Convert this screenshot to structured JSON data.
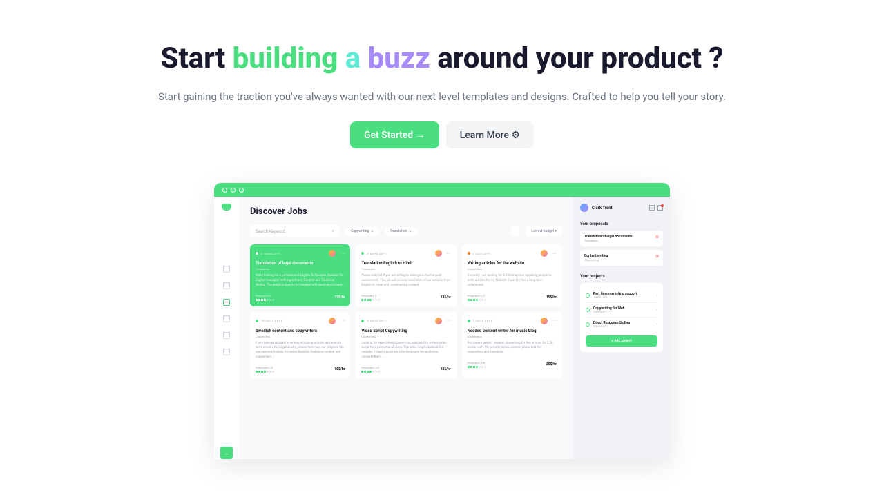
{
  "hero": {
    "title_pre": "Start ",
    "title_g1": "building ",
    "title_g2": "a ",
    "title_g3": "buzz",
    "title_post": " around your product ?",
    "subtitle": "Start gaining the traction you've always wanted with our next-level templates and designs. Crafted to help you tell your story.",
    "cta_primary": "Get Started →",
    "cta_secondary": "Learn More ⚙"
  },
  "app": {
    "heading": "Discover Jobs",
    "search_placeholder": "Search Keyword",
    "chip1": "Copywriting",
    "chip2": "Translation",
    "sort": "Lowest budget",
    "cards": [
      {
        "days": "4 DAYS LEFT",
        "title": "Translation of legal documents",
        "sub": "Translation",
        "desc": "We're looking for a professional English-To-Russian, Russian-To-English translator with expertise in Content and Technical Writing. The script is soon to be finished with exact word count...",
        "prop": "Proposers 8",
        "rate": "12$/hr"
      },
      {
        "days": "5 DAYS LEFT",
        "title": "Translation English to Hindi",
        "sub": "Translation",
        "desc": "Please only bid if you are willing to undergo a short unpaid assessment. This job will include translation of our website from English to Hindi and proofreading content.",
        "prop": "Proposers 5",
        "rate": "13$/hr"
      },
      {
        "days": "1 DAY LEFT",
        "title": "Writing articles for the website",
        "sub": "Copywriting",
        "desc": "Currently I am looking for 2-3 Vietnamese speaking people to write articles for my Website. I want to find a long-term collaborator.",
        "prop": "Proposers 2/5",
        "rate": "15$/hr"
      },
      {
        "days": "10 DAYS LEFT",
        "title": "Swedish content and copywriters",
        "sub": "Copywriting",
        "desc": "If you have a passion for writing intriguing articles and want to write about a thriving industry, please then read our job post. We are currently looking for native Swedish freelance content and copywriters...",
        "prop": "Proposers 2/8",
        "rate": "16$/hr"
      },
      {
        "days": "4 DAYS LEFT",
        "title": "Video Script Copywriting",
        "sub": "Copywriting",
        "desc": "Looking for expert level Copywriting specialist to write a video script for a promotional video. The video length is about 2-3 minutes. I need a good story that engages the audience, converts them...",
        "prop": "Proposers 3/8",
        "rate": "18$/hr"
      },
      {
        "days": "2 DAYS LEFT",
        "title": "Needed content writer for music blog",
        "sub": "Copywriting",
        "desc": "For current project needed copywriting for five articles for 2.5k words each. We provide topics, content plans, text for copywriting and keywords.",
        "prop": "Proposers 3/8",
        "rate": "20$/hr"
      }
    ]
  },
  "right": {
    "user": "Clark Trent",
    "proposals_title": "Your proposals",
    "proposals": [
      {
        "title": "Translation of legal documents",
        "sub": "Translation"
      },
      {
        "title": "Content writing",
        "sub": "Copywriting"
      }
    ],
    "projects_title": "Your projects",
    "projects": [
      {
        "title": "Part time marketing support",
        "meta": "4 DAYS LEFT"
      },
      {
        "title": "Copywriting for Web",
        "meta": "5 DAYS LEFT"
      },
      {
        "title": "Direct Response Selling",
        "meta": "3 DAYS LEFT"
      }
    ],
    "add": "+  Add project"
  }
}
